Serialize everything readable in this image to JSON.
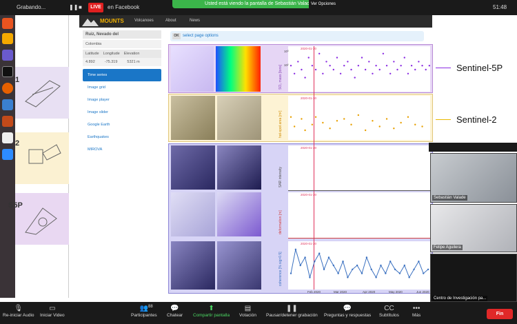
{
  "topbar": {
    "recording": "Grabando...",
    "live": "LIVE",
    "stream_target": "en Facebook",
    "share_notice": "Usted está viendo la pantalla de Sebastián Valade",
    "view_options": "Ver Opciones",
    "clock": "51:48"
  },
  "site": {
    "brand": "MOUNTS",
    "nav": [
      "Volcanoes",
      "About",
      "News"
    ]
  },
  "volcano": {
    "name": "Ruiz, Nevado del",
    "country": "Colombia",
    "headers": [
      "Latitude",
      "Longitude",
      "Elevation"
    ],
    "values": [
      "4.892",
      "-75.319",
      "5321 m"
    ]
  },
  "menu": [
    "Time series",
    "Image grid",
    "Image player",
    "Image slider",
    "Google Earth",
    "Earthquakes",
    "MIROVA"
  ],
  "page_options": {
    "button": "OK",
    "label": "select page options"
  },
  "sat_labels": [
    "1",
    "2",
    "S5P"
  ],
  "legend": [
    {
      "label": "Sentinel-5P",
      "color": "#8a2be2"
    },
    {
      "label": "Sentinel-2",
      "color": "#e8b800"
    }
  ],
  "sections": {
    "s5p_color": "#e6d6f5",
    "s2_color": "#fdf3d4",
    "s1_color": "#d7d4f6"
  },
  "plots": [
    {
      "ylabel": "SO₂ mass [tons]",
      "date": "2020-01-30",
      "ytick": [
        "10³",
        "10²"
      ]
    },
    {
      "ylabel": "hot-spot area [m²]",
      "date": "2020-01-30"
    },
    {
      "ylabel": "SAR intensity",
      "date": "2020-01-30"
    },
    {
      "ylabel": "deformation [m]",
      "date": "2020-01-30"
    },
    {
      "ylabel": "coherence [% sig>0.5]",
      "date": "2020-01-30"
    }
  ],
  "x_ticks": [
    "Feb 2020",
    "Mar 2020",
    "Apr 2020",
    "May 2020",
    "Jun 2020"
  ],
  "chart_data": [
    {
      "type": "scatter",
      "ylabel": "SO₂ mass [tons]",
      "x": [
        0,
        1,
        2,
        3,
        4,
        5,
        6,
        7,
        8,
        9,
        10,
        11,
        12,
        13,
        14,
        15,
        16,
        17,
        18,
        19,
        20,
        21,
        22,
        23,
        24,
        25,
        26,
        27,
        28,
        29,
        30,
        31,
        32,
        33,
        34,
        35,
        36,
        37,
        38,
        39
      ],
      "values": [
        0.6,
        0.4,
        0.7,
        0.5,
        0.3,
        0.8,
        0.6,
        0.5,
        0.9,
        0.4,
        0.7,
        0.6,
        0.5,
        0.8,
        0.4,
        0.6,
        0.7,
        0.5,
        0.3,
        0.6,
        0.8,
        0.5,
        0.7,
        0.4,
        0.6,
        0.5,
        0.9,
        0.6,
        0.4,
        0.7,
        0.5,
        0.6,
        0.8,
        0.4,
        0.6,
        0.5,
        0.7,
        0.6,
        0.5,
        0.6
      ]
    },
    {
      "type": "scatter",
      "ylabel": "hot-spot area [m²]",
      "x": [
        0,
        1,
        3,
        4,
        6,
        7,
        9,
        11,
        13,
        15,
        17,
        19,
        21,
        23,
        25,
        27,
        29,
        31,
        33,
        35,
        37
      ],
      "values": [
        0.55,
        0.3,
        0.5,
        0.2,
        0.35,
        0.55,
        0.4,
        0.25,
        0.45,
        0.5,
        0.35,
        0.6,
        0.2,
        0.45,
        0.3,
        0.5,
        0.25,
        0.4,
        0.55,
        0.35,
        0.3
      ]
    },
    {
      "type": "line",
      "ylabel": "coherence [% sig>0.5]",
      "x": [
        0,
        1,
        2,
        3,
        4,
        5,
        6,
        7,
        8,
        9,
        10,
        11,
        12,
        13,
        14,
        15,
        16,
        17,
        18,
        19,
        20,
        21,
        22,
        23,
        24,
        25,
        26,
        27,
        28,
        29
      ],
      "values": [
        0.3,
        0.9,
        0.5,
        0.7,
        0.2,
        0.6,
        0.8,
        0.4,
        0.7,
        0.5,
        0.3,
        0.6,
        0.2,
        0.4,
        0.5,
        0.3,
        0.7,
        0.4,
        0.2,
        0.5,
        0.3,
        0.6,
        0.4,
        0.3,
        0.5,
        0.2,
        0.4,
        0.6,
        0.3,
        0.4
      ]
    }
  ],
  "participants": [
    {
      "name": "Sebastián Valade"
    },
    {
      "name": "Felipe Aguilera"
    },
    {
      "name": "Centro de Investigación pa..."
    }
  ],
  "toolbar": [
    "Re-iniciar Audio",
    "Iniciar Video",
    "Participantes",
    "Chatear",
    "Compartir pantalla",
    "Votación",
    "Pausar/detener grabación",
    "Preguntas y respuestas",
    "Subtítulos",
    "Más"
  ],
  "toolbar_icons": [
    "mic-icon",
    "video-icon",
    "participants-icon",
    "chat-icon",
    "share-icon",
    "poll-icon",
    "pause-icon",
    "qa-icon",
    "cc-icon",
    "more-icon"
  ],
  "participants_count": "88",
  "end_label": "Fin"
}
